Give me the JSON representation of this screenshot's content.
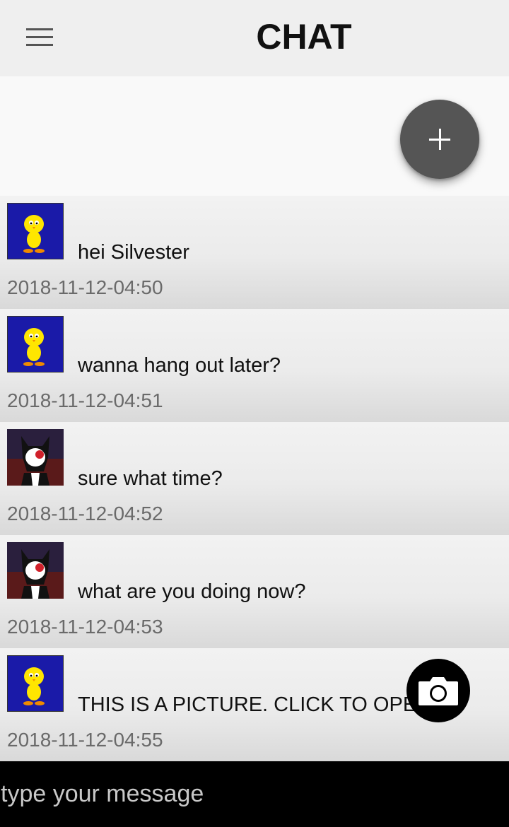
{
  "header": {
    "title": "CHAT",
    "menu_icon": "hamburger-menu-icon"
  },
  "fab": {
    "icon": "plus-icon"
  },
  "messages": [
    {
      "avatar": "tweety",
      "text": "hei Silvester",
      "time": "2018-11-12-04:50"
    },
    {
      "avatar": "tweety",
      "text": "wanna hang out later?",
      "time": "2018-11-12-04:51"
    },
    {
      "avatar": "sylvester",
      "text": "sure what time?",
      "time": "2018-11-12-04:52"
    },
    {
      "avatar": "sylvester",
      "text": "what are you doing now?",
      "time": "2018-11-12-04:53"
    },
    {
      "avatar": "tweety",
      "text": "THIS IS A PICTURE. CLICK TO OPEN",
      "time": "2018-11-12-04:55"
    }
  ],
  "picture_button": {
    "icon": "camera-icon"
  },
  "composer": {
    "placeholder": "type your message"
  },
  "colors": {
    "appbar": "#efefef",
    "fab": "#555555",
    "input_bar": "#000000",
    "tweety_bg": "#1a1aa8",
    "sylvester_bg": "#2a1f3d"
  }
}
